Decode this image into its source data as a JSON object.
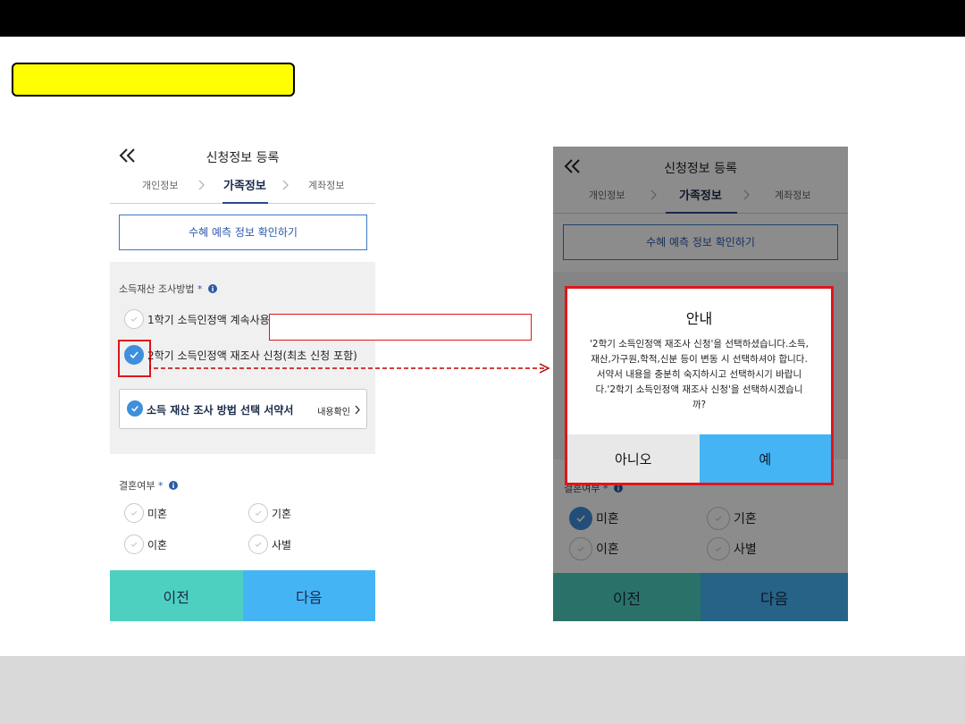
{
  "left_screen": {
    "header_title": "신청정보 등록",
    "steps": [
      "개인정보",
      "가족정보",
      "계좌정보"
    ],
    "active_step": 1,
    "benefit_button_label": "수혜 예측 정보 확인하기",
    "income_section_label": "소득재산 조사방법",
    "required_mark": "*",
    "options": [
      {
        "label": "1학기 소득인정액 계속사용(",
        "checked": false
      },
      {
        "label": "2학기 소득인정액 재조사 신청(최초 신청 포함)",
        "checked": true
      }
    ],
    "agreement_label": "소득 재산 조사 방법 선택 서약서",
    "agreement_link": "내용확인",
    "marriage_label": "결혼여부",
    "marriage_options": [
      "미혼",
      "기혼",
      "이혼",
      "사별"
    ],
    "prev_button": "이전",
    "next_button": "다음"
  },
  "right_screen": {
    "header_title": "신청정보 등록",
    "steps": [
      "개인정보",
      "가족정보",
      "계좌정보"
    ],
    "benefit_button_label": "수혜 예측 정보 확인하기",
    "marriage_label": "결혼여부",
    "marriage_options": [
      "미혼",
      "기혼",
      "이혼",
      "사별"
    ],
    "marriage_selected": "미혼",
    "prev_button": "이전",
    "next_button": "다음"
  },
  "dialog": {
    "title": "안내",
    "body_lines": [
      "'2학기 소득인정액 재조사 신청'을 선택하셨습니다.소득,",
      "재산,가구원,학적,신분 등이 변동 시 선택하셔야 합니다.",
      "서약서 내용을 충분히 숙지하시고 선택하시기 바랍니",
      "다.'2학기 소득인정액 재조사 신청'을 선택하시겠습니",
      "까?"
    ],
    "no_button": "아니오",
    "yes_button": "예"
  },
  "colors": {
    "accent_blue": "#3f8fdc",
    "prev_teal": "#4dd0c0",
    "next_blue": "#45b4f5",
    "highlight_red": "#e0161b",
    "label_yellow": "#ffff00"
  },
  "icons": {
    "back": "double-chevron-left-icon",
    "check": "checkmark-icon",
    "info": "info-circle-icon",
    "step_separator": "chevron-right-icon",
    "agreement_link": "chevron-right-icon"
  }
}
